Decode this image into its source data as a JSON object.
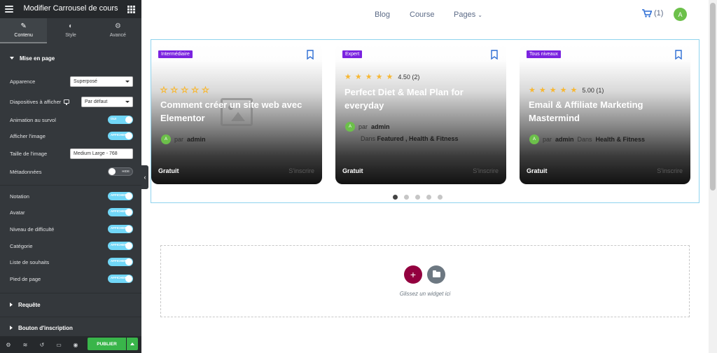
{
  "panel": {
    "title": "Modifier Carrousel de cours",
    "tabs": [
      {
        "label": "Contenu",
        "icon": "pencil-icon"
      },
      {
        "label": "Style",
        "icon": "half-circle-icon"
      },
      {
        "label": "Avancé",
        "icon": "gear-icon"
      }
    ],
    "section_layout": "Mise en page",
    "controls": {
      "apparence": {
        "label": "Apparence",
        "value": "Superposé"
      },
      "slides": {
        "label": "Diapositives à afficher",
        "value": "Par défaut"
      },
      "hover_anim": {
        "label": "Animation au survol",
        "state": "OUI"
      },
      "show_image": {
        "label": "Afficher l'image",
        "state": "AFFICHER"
      },
      "image_size": {
        "label": "Taille de l'image",
        "value": "Medium Large - 768"
      },
      "metadata": {
        "label": "Métadonnées",
        "state": "HIDE"
      },
      "rating": {
        "label": "Notation",
        "state": "AFFICHER"
      },
      "avatar": {
        "label": "Avatar",
        "state": "AFFICHER"
      },
      "difficulty": {
        "label": "Niveau de difficulté",
        "state": "AFFICHER"
      },
      "category": {
        "label": "Catégorie",
        "state": "AFFICHER"
      },
      "wishlist": {
        "label": "Liste de souhaits",
        "state": "AFFICHER"
      },
      "footer": {
        "label": "Pied de page",
        "state": "AFFICHER"
      }
    },
    "section_query": "Requête",
    "section_enroll": "Bouton d'inscription",
    "publish_label": "PUBLIER"
  },
  "nav": {
    "links": [
      "Blog",
      "Course",
      "Pages"
    ],
    "cart_count": "(1)",
    "avatar_letter": "A"
  },
  "cards": [
    {
      "badge": "Intermédiaire",
      "rating": 0,
      "rating_text": "",
      "title": "Comment créer un site web avec Elementor",
      "author_prefix": "par",
      "author": "admin",
      "avatar_letter": "A",
      "price": "Gratuit",
      "enroll": "S'inscrire"
    },
    {
      "badge": "Expert",
      "rating": 4.5,
      "rating_text": "4.50 (2)",
      "title": "Perfect Diet & Meal Plan for everyday",
      "author_prefix": "par",
      "author": "admin",
      "avatar_letter": "A",
      "category_prefix": "Dans",
      "categories": "Featured ,  Health & Fitness",
      "price": "Gratuit",
      "enroll": "S'inscrire"
    },
    {
      "badge": "Tous niveaux",
      "rating": 5,
      "rating_text": "5.00 (1)",
      "title": "Email & Affiliate Marketing Mastermind",
      "author_prefix": "par",
      "author": "admin",
      "avatar_letter": "A",
      "category_prefix": "Dans",
      "categories": "Health & Fitness",
      "price": "Gratuit",
      "enroll": "S'inscrire"
    }
  ],
  "pagination": {
    "count": 5,
    "active": 1
  },
  "dropzone": {
    "label": "Glissez un widget ici"
  },
  "colors": {
    "accent": "#7b23e0",
    "toggle_on": "#71d7f7",
    "publish": "#39b54a",
    "add": "#93003f",
    "avatar": "#6cc04a"
  }
}
